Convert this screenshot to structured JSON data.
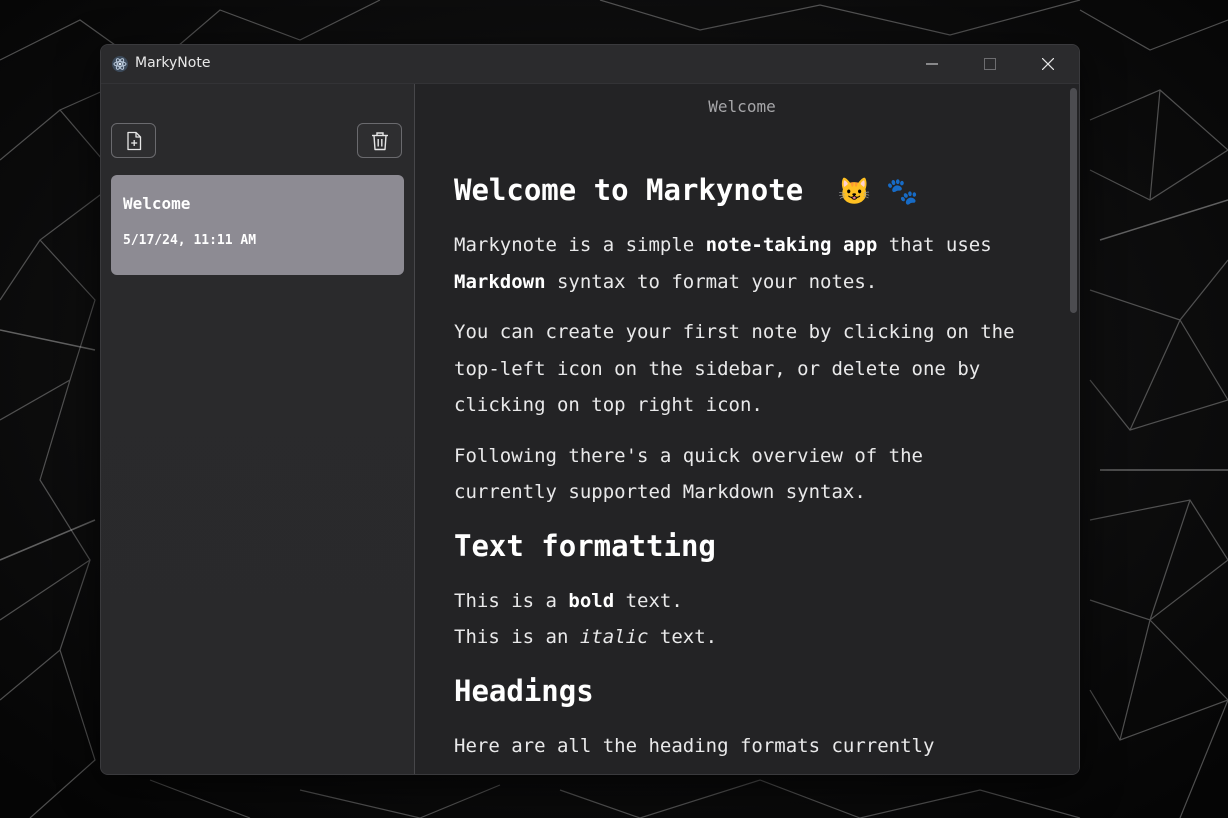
{
  "window": {
    "title": "MarkyNote",
    "controls": {
      "minimize": "minimize-icon",
      "maximize": "maximize-icon",
      "close": "close-icon"
    }
  },
  "sidebar": {
    "new_note_icon": "file-plus-icon",
    "delete_note_icon": "trash-icon",
    "notes": [
      {
        "title": "Welcome",
        "date": "5/17/24, 11:11 AM",
        "selected": true
      }
    ]
  },
  "editor": {
    "header": "Welcome",
    "h1": {
      "text": "Welcome to Markynote",
      "emoji": "😺 🐾"
    },
    "p1": {
      "a": "Markynote is a simple ",
      "b1": "note-taking app",
      "c": " that uses ",
      "b2": "Markdown",
      "d": " syntax to format your notes."
    },
    "p2": "You can create your first note by clicking on the top-left icon on the sidebar, or delete one by clicking on top right icon.",
    "p3": "Following there's a quick overview of the currently supported Markdown syntax.",
    "h2_text": "Text formatting",
    "line_bold": {
      "a": "This is a ",
      "b": "bold",
      "c": " text."
    },
    "line_italic": {
      "a": "This is an ",
      "i": "italic",
      "c": " text."
    },
    "h2_headings": "Headings",
    "partial_line": "Here are all the heading formats currently"
  },
  "colors": {
    "selected_note": "#8d8b93",
    "editor_bg": "#232325",
    "sidebar_bg": "#2a2a2c"
  }
}
